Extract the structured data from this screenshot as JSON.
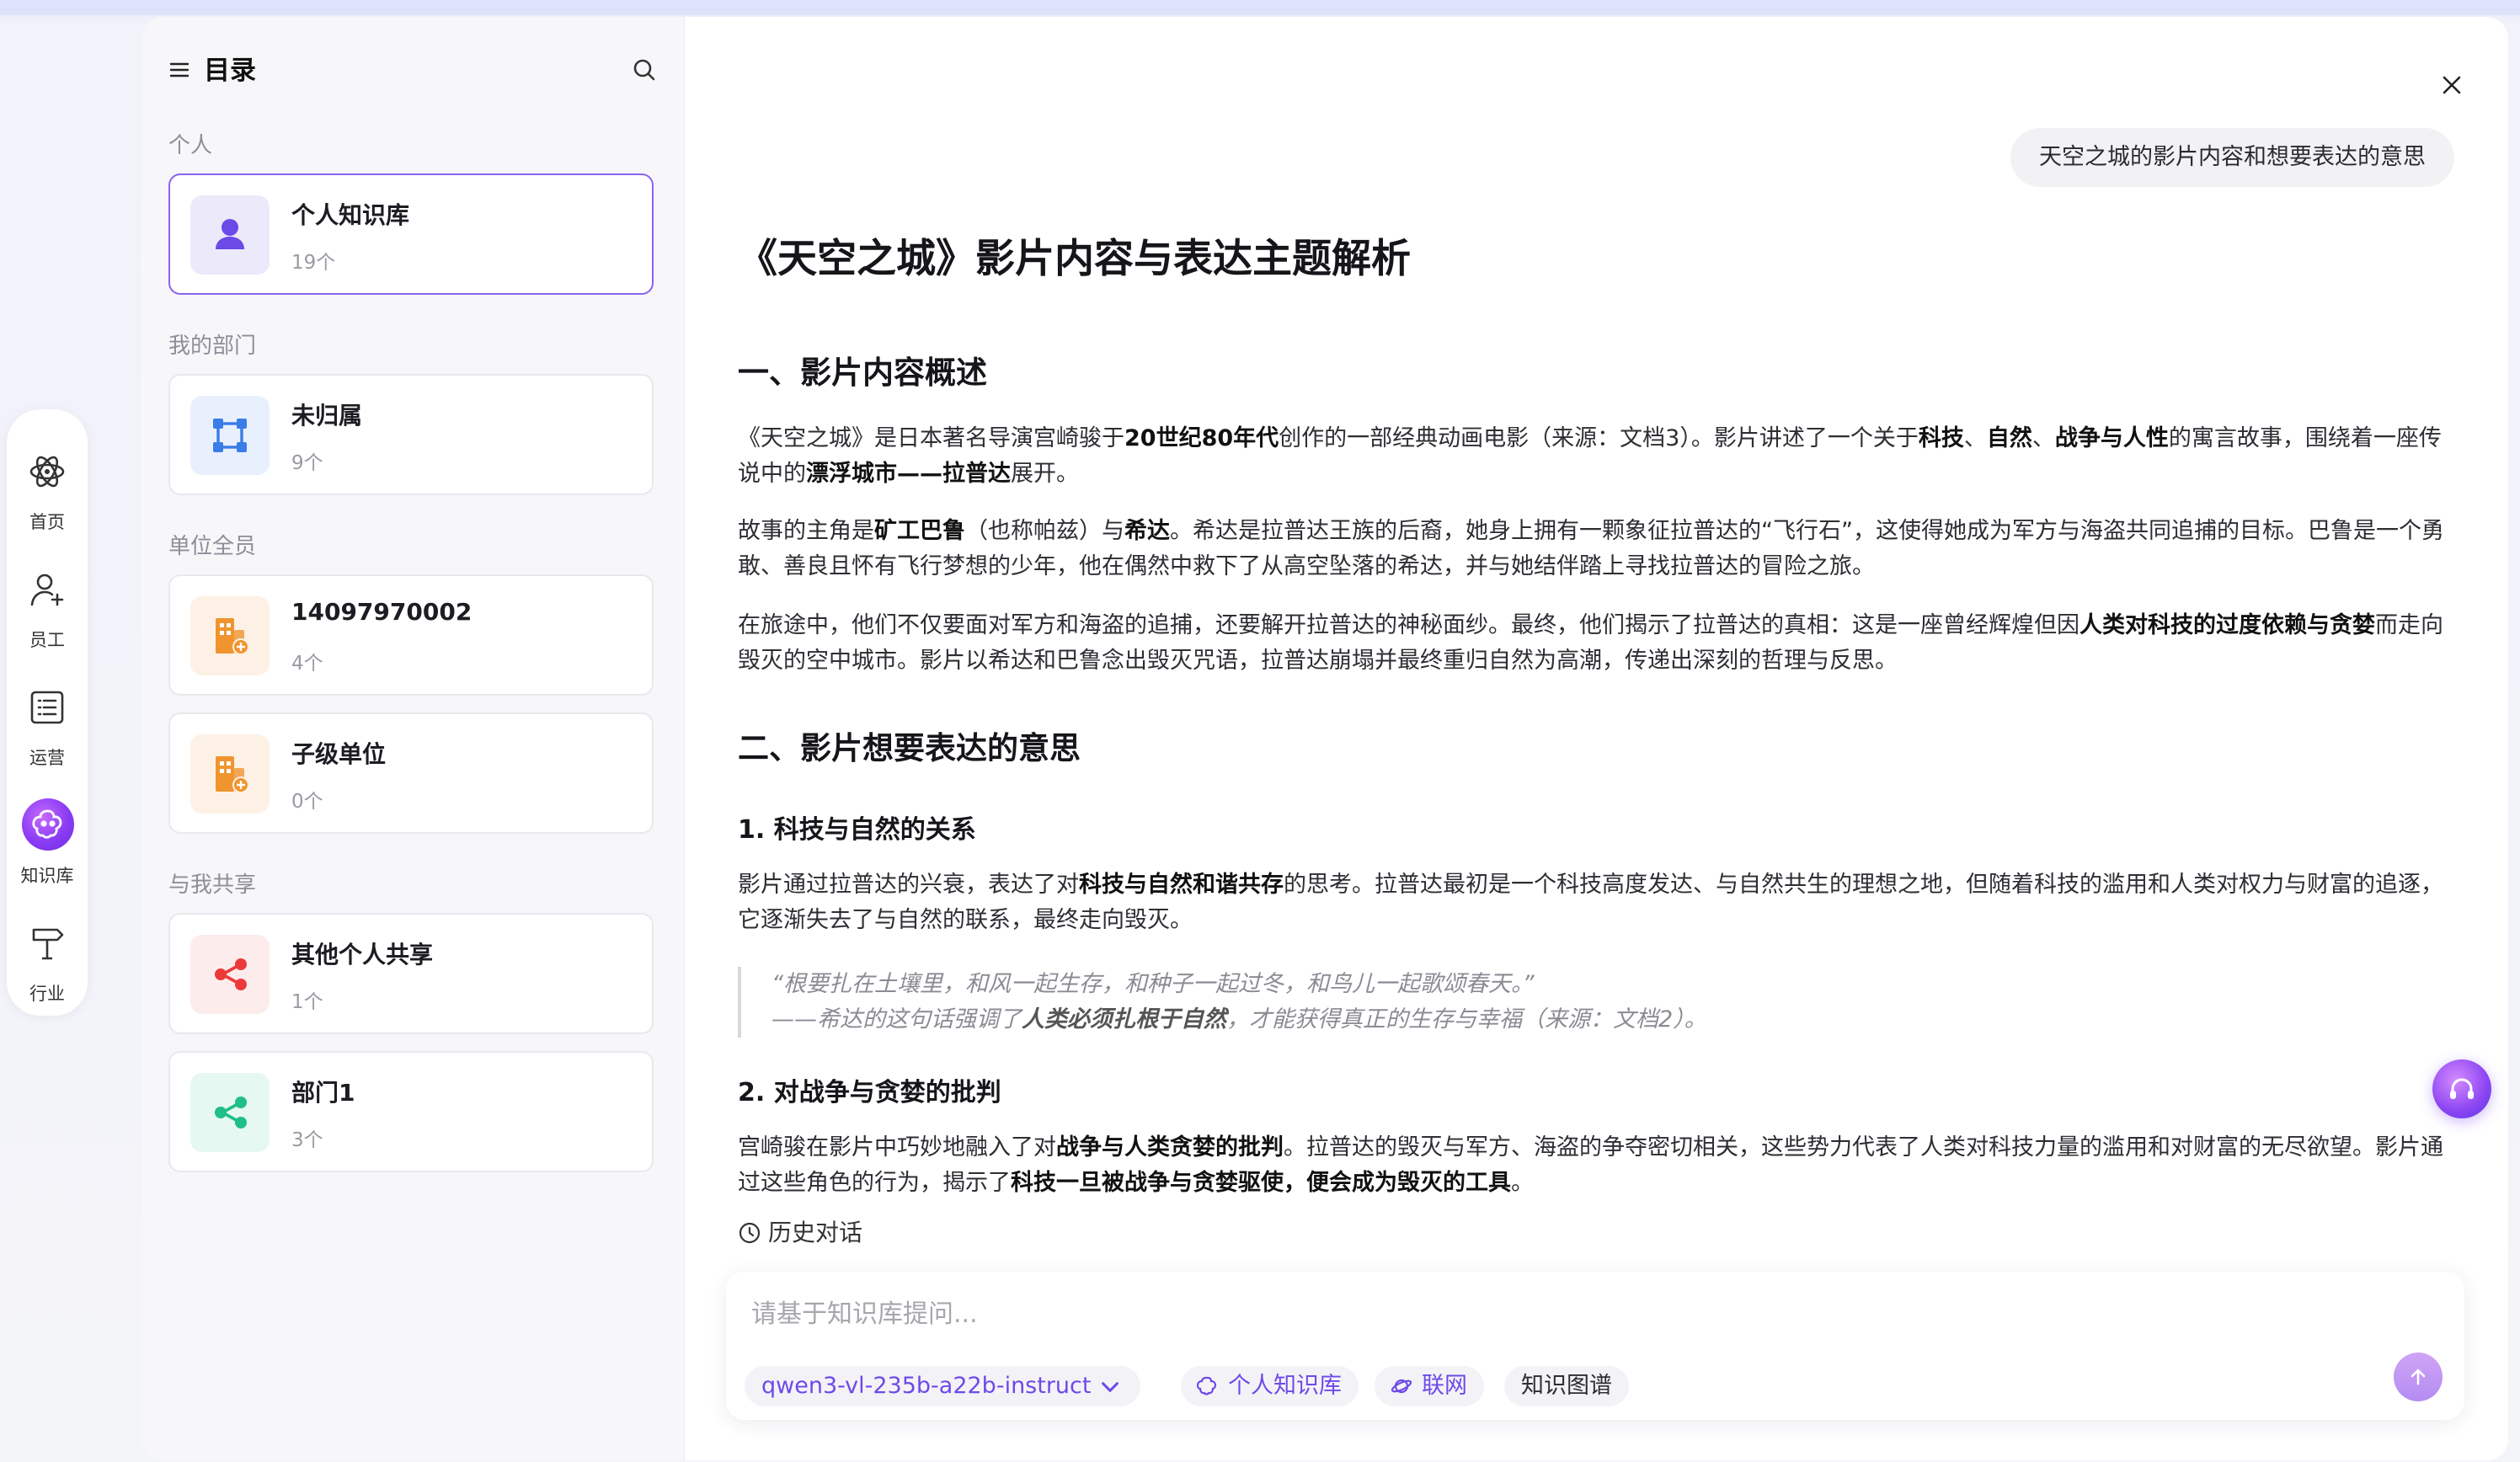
{
  "rail": {
    "items": [
      {
        "label": "首页",
        "icon": "atom-icon"
      },
      {
        "label": "员工",
        "icon": "user-plus-icon"
      },
      {
        "label": "运营",
        "icon": "list-icon"
      },
      {
        "label": "知识库",
        "icon": "knowledge-base-icon"
      },
      {
        "label": "行业",
        "icon": "signpost-icon"
      }
    ],
    "active_index": 3
  },
  "sidebar": {
    "title": "目录",
    "sections": {
      "personal": "个人",
      "department": "我的部门",
      "unit_all": "单位全员",
      "shared": "与我共享"
    },
    "cards": [
      {
        "name": "个人知识库",
        "count": "19个",
        "icon": "person-icon",
        "active": true
      },
      {
        "name": "未归属",
        "count": "9个",
        "icon": "department-icon"
      },
      {
        "name": "14097970002",
        "count": "4个",
        "icon": "building-icon"
      },
      {
        "name": "子级单位",
        "count": "0个",
        "icon": "building-icon"
      },
      {
        "name": "其他个人共享",
        "count": "1个",
        "icon": "share-icon"
      },
      {
        "name": "部门1",
        "count": "3个",
        "icon": "share-icon"
      }
    ]
  },
  "chat": {
    "user_message": "天空之城的影片内容和想要表达的意思",
    "title": "《天空之城》影片内容与表达主题解析",
    "section1_title": "一、影片内容概述",
    "section2_title": "二、影片想要表达的意思",
    "sub1_title": "1. 科技与自然的关系",
    "sub2_title": "2. 对战争与贪婪的批判",
    "history_label": "历史对话"
  },
  "composer": {
    "placeholder": "请基于知识库提问...",
    "model": "qwen3-vl-235b-a22b-instruct",
    "kb_chip": "个人知识库",
    "web_chip": "联网",
    "graph_chip": "知识图谱"
  },
  "colors": {
    "accent": "#7b55ee",
    "active_border": "#8a63f0",
    "person_bg": "#ece9fb",
    "dept_bg": "#e9f0fd",
    "building_bg": "#fdf1e6",
    "share_red_bg": "#fdecec",
    "share_green_bg": "#e5f8f1"
  }
}
